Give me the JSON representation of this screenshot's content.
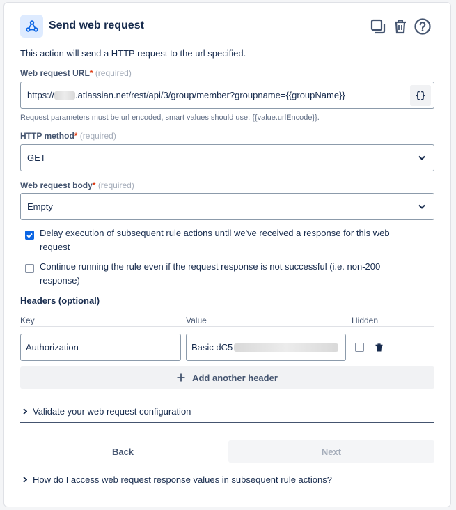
{
  "header": {
    "title": "Send web request",
    "icons": [
      "webhook-icon",
      "duplicate-icon",
      "trash-icon",
      "help-icon"
    ]
  },
  "description": "This action will send a HTTP request to the url specified.",
  "url_field": {
    "label": "Web request URL",
    "required_text": "(required)",
    "value_prefix": "https://",
    "value_suffix": ".atlassian.net/rest/api/3/group/member?groupname={{groupName}}",
    "smart_value_button": "{}",
    "helper": "Request parameters must be url encoded, smart values should use: {{value.urlEncode}}."
  },
  "method_field": {
    "label": "HTTP method",
    "required_text": "(required)",
    "value": "GET"
  },
  "body_field": {
    "label": "Web request body",
    "required_text": "(required)",
    "value": "Empty"
  },
  "options": {
    "delay": {
      "checked": true,
      "text": "Delay execution of subsequent rule actions until we've received a response for this web request"
    },
    "continue": {
      "checked": false,
      "text": "Continue running the rule even if the request response is not successful (i.e. non-200 response)"
    }
  },
  "headers": {
    "title": "Headers (optional)",
    "col_key": "Key",
    "col_value": "Value",
    "col_hidden": "Hidden",
    "rows": [
      {
        "key": "Authorization",
        "value_prefix": "Basic dC5",
        "hidden": false
      }
    ],
    "add_label": "Add another header"
  },
  "validate_label": "Validate your web request configuration",
  "buttons": {
    "back": "Back",
    "next": "Next"
  },
  "faq_label": "How do I access web request response values in subsequent rule actions?",
  "colors": {
    "accent": "#0c66e4",
    "required": "#de350b",
    "icon_bg": "#deebff"
  }
}
